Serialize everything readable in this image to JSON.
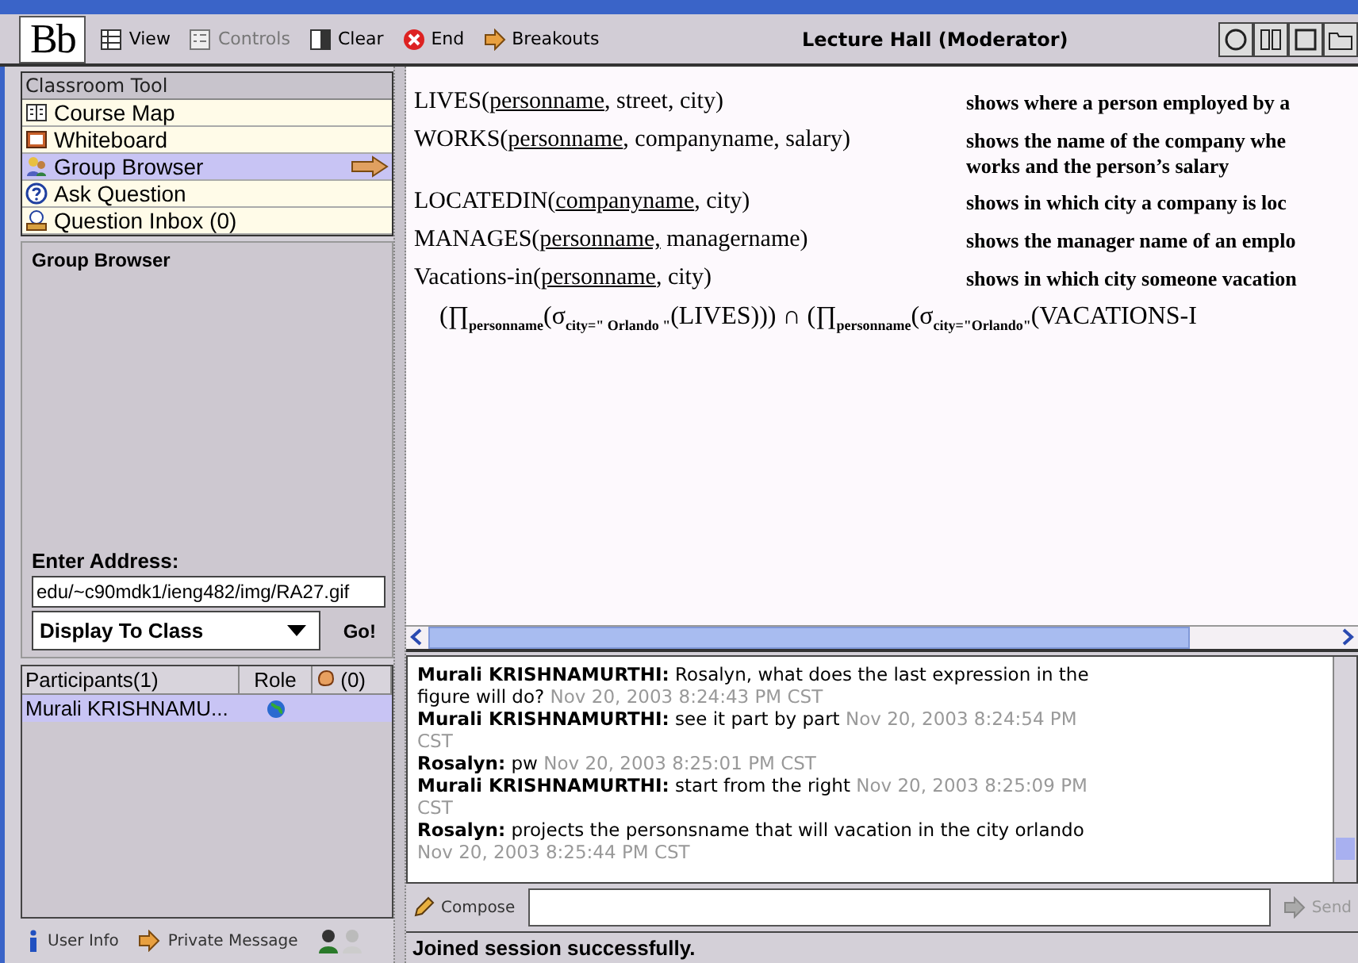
{
  "toolbar": {
    "logo": "Bb",
    "buttons": [
      {
        "kind": "view",
        "label": "View",
        "disabled": false
      },
      {
        "kind": "controls",
        "label": "Controls",
        "disabled": true
      },
      {
        "kind": "clear",
        "label": "Clear",
        "disabled": false
      },
      {
        "kind": "end",
        "label": "End",
        "disabled": false
      },
      {
        "kind": "breakouts",
        "label": "Breakouts",
        "disabled": false
      }
    ],
    "title": "Lecture Hall (Moderator)"
  },
  "tools": {
    "heading": "Classroom Tool",
    "items": [
      {
        "kind": "map",
        "label": "Course Map",
        "selected": false
      },
      {
        "kind": "board",
        "label": "Whiteboard",
        "selected": false
      },
      {
        "kind": "group",
        "label": "Group Browser",
        "selected": true
      },
      {
        "kind": "ask",
        "label": "Ask Question",
        "selected": false
      },
      {
        "kind": "inbox",
        "label": "Question Inbox (0)",
        "selected": false
      }
    ]
  },
  "group_browser": {
    "title": "Group Browser",
    "address_label": "Enter Address:",
    "address": "edu/~c90mdk1/ieng482/img/RA27.gif",
    "display": "Display To Class",
    "go": "Go!"
  },
  "whiteboard": {
    "relations": [
      {
        "name": "LIVES(",
        "key": "personname",
        "rest": ", street, city)",
        "description": [
          "shows where a person employed by a"
        ]
      },
      {
        "name": "WORKS(",
        "key": "personname",
        "rest": ", companyname, salary)",
        "description": [
          "shows the name of the company whe",
          "works and the person’s salary"
        ]
      },
      {
        "name": "LOCATEDIN(",
        "key": "companyname",
        "rest": ", city)",
        "description": [
          "shows in which city a company is loc"
        ]
      },
      {
        "name": "MANAGES(",
        "key": "personname,",
        "rest": " managername)",
        "description": [
          "shows the manager name of an emplo"
        ]
      },
      {
        "name": "Vacations-in(",
        "key": "personname",
        "rest": ", city)",
        "description": [
          "shows in which city someone vacation"
        ]
      }
    ],
    "expression": "(∏$_{personname}$(σ$_{city=\" Orlando \"}$(LIVES))) ∩ (∏$_{personname}$(σ$_{city=\"Orlando\"}$(VACATIONS-I"
  },
  "participants": {
    "columns": [
      "Participants(1)",
      "Role",
      "(0)"
    ],
    "rows": [
      {
        "name": "Murali KRISHNAMU...",
        "selected": true
      }
    ]
  },
  "user_actions": [
    "User Info",
    "Private Message"
  ],
  "chat": [
    {
      "sender": "Murali KRISHNAMURTHI:",
      "text": "Rosalyn, what does the last expression in the figure will do?",
      "time": "Nov 20, 2003 8:24:43 PM CST"
    },
    {
      "sender": "Murali KRISHNAMURTHI:",
      "text": "see it part by part",
      "time": "Nov 20, 2003 8:24:54 PM CST"
    },
    {
      "sender": "Rosalyn:",
      "text": "pw",
      "time": "Nov 20, 2003 8:25:01 PM CST"
    },
    {
      "sender": "Murali KRISHNAMURTHI:",
      "text": "start from the right",
      "time": "Nov 20, 2003 8:25:09 PM CST"
    },
    {
      "sender": "Rosalyn:",
      "text": "projects the personsname that will vacation in the city orlando",
      "time": "Nov 20, 2003 8:25:44 PM CST"
    }
  ],
  "compose": {
    "label": "Compose",
    "send": "Send",
    "send_disabled": true
  },
  "status_bar": "Joined session successfully."
}
